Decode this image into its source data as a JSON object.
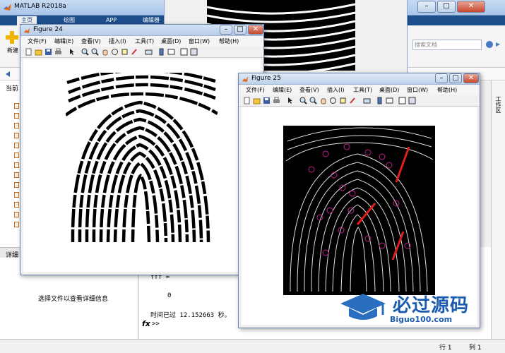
{
  "matlab": {
    "title": "MATLAB R2018a",
    "ribbon_tabs": [
      "主页",
      "绘图",
      "APP",
      "编辑器"
    ],
    "new_label": "新建",
    "search_placeholder": "搜索文档",
    "current_folder_label": "当前",
    "details_title": "详细",
    "details_message": "选择文件以查看详细信息",
    "command": {
      "line1": "fff =",
      "line2": "0",
      "line3": "时间已过 12.152663 秒。",
      "prompt": "fx",
      "arrows": ">>"
    },
    "workspace_label": "工作区",
    "status": {
      "row": "行 1",
      "col": "列 1"
    }
  },
  "figures": [
    {
      "title": "Figure 24",
      "menu": [
        "文件(F)",
        "编辑(E)",
        "查看(V)",
        "插入(I)",
        "工具(T)",
        "桌面(D)",
        "窗口(W)",
        "帮助(H)"
      ]
    },
    {
      "title": "Figure 25",
      "menu": [
        "文件(F)",
        "编辑(E)",
        "查看(V)",
        "插入(I)",
        "工具(T)",
        "桌面(D)",
        "窗口(W)",
        "帮助(H)"
      ]
    }
  ],
  "watermark": {
    "name": "必过源码",
    "url": "Biguo100.com"
  },
  "colors": {
    "ribbon_blue": "#1e4f8d",
    "minutiae_red": "#e0201a",
    "minutiae_magenta": "#c0208a"
  }
}
